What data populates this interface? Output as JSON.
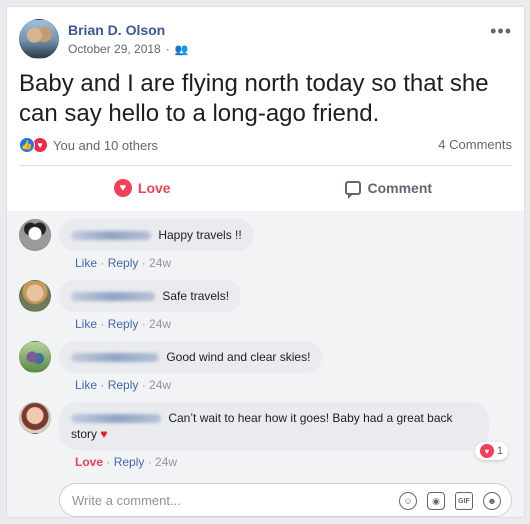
{
  "post": {
    "author": "Brian D. Olson",
    "date": "October 29, 2018",
    "audience_icon": "friends-icon",
    "text": "Baby and I are flying north today so that she can say hello to a long-ago friend."
  },
  "stats": {
    "reactions_text": "You and 10 others",
    "comments_text": "4 Comments"
  },
  "actions": {
    "love_label": "Love",
    "comment_label": "Comment"
  },
  "comments": [
    {
      "text": "Happy travels !!",
      "like": "Like",
      "reply": "Reply",
      "time": "24w"
    },
    {
      "text": "Safe travels!",
      "like": "Like",
      "reply": "Reply",
      "time": "24w"
    },
    {
      "text": "Good wind and clear skies!",
      "like": "Like",
      "reply": "Reply",
      "time": "24w"
    },
    {
      "text": "Can’t wait to hear how it goes! Baby had a great back story",
      "like": "Love",
      "reply": "Reply",
      "time": "24w",
      "reaction_count": "1"
    }
  ],
  "composer": {
    "placeholder": "Write a comment..."
  },
  "colors": {
    "link_blue": "#385898",
    "love_red": "#f33e58",
    "like_blue": "#1877f2"
  }
}
